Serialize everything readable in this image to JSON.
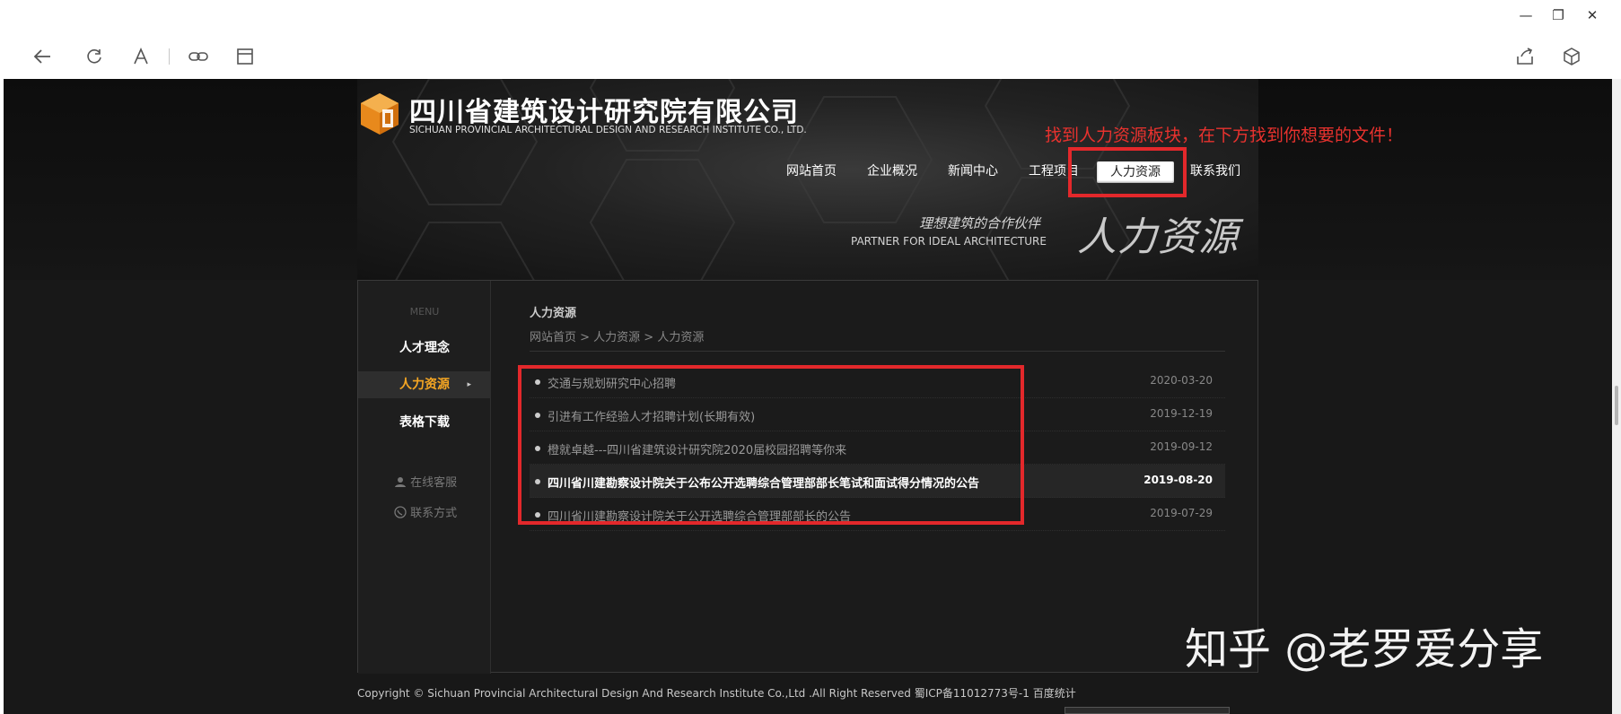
{
  "window": {
    "minimize_glyph": "—",
    "restore_glyph": "❐",
    "close_glyph": "✕"
  },
  "toolbar": {
    "icons": [
      "back-icon",
      "refresh-icon",
      "text-size-icon",
      "link-icon",
      "reader-icon",
      "share-icon",
      "box-icon"
    ]
  },
  "site": {
    "logo_title": "四川省建筑设计研究院有限公司",
    "logo_subtitle": "SICHUAN PROVINCIAL ARCHITECTURAL DESIGN AND RESEARCH INSTITUTE CO., LTD.",
    "annotation": "找到人力资源板块，在下方找到你想要的文件！",
    "nav": [
      "网站首页",
      "企业概况",
      "新闻中心",
      "工程项目",
      "人力资源",
      "联系我们"
    ],
    "slogan_cn": "理想建筑的合作伙伴",
    "slogan_en": "PARTNER FOR IDEAL ARCHITECTURE",
    "banner_title": "人力资源"
  },
  "sidebar": {
    "menu_label": "MENU",
    "items": [
      "人才理念",
      "人力资源",
      "表格下载"
    ],
    "arrow": "▸",
    "links": [
      "在线客服",
      "联系方式"
    ]
  },
  "main": {
    "title": "人力资源",
    "breadcrumb": "网站首页 >  人力资源 >  人力资源",
    "rows": [
      {
        "title": "交通与规划研究中心招聘",
        "date": "2020-03-20"
      },
      {
        "title": "引进有工作经验人才招聘计划(长期有效)",
        "date": "2019-12-19"
      },
      {
        "title": "橙就卓越---四川省建筑设计研究院2020届校园招聘等你来",
        "date": "2019-09-12"
      },
      {
        "title": "四川省川建勘察设计院关于公布公开选聘综合管理部部长笔试和面试得分情况的公告",
        "date": "2019-08-20"
      },
      {
        "title": "四川省川建勘察设计院关于公开选聘综合管理部部长的公告",
        "date": "2019-07-29"
      }
    ]
  },
  "footer": {
    "copyright": "Copyright © Sichuan Provincial Architectural Design And Research Institute Co.,Ltd .All Right Reserved 蜀ICP备11012773号-1 百度统计"
  },
  "watermark": "知乎 @老罗爱分享",
  "colors": {
    "accent": "#f5a623",
    "annotation_red": "#e3282b"
  }
}
